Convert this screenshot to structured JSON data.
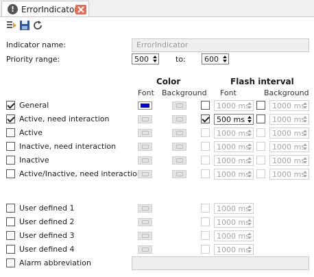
{
  "tab": {
    "title": "ErrorIndicator *"
  },
  "toolbar": {
    "icons": [
      "export-icon",
      "save-icon",
      "refresh-icon"
    ]
  },
  "form": {
    "name_label": "Indicator name:",
    "name_value": "ErrorIndicator",
    "priority_label": "Priority range:",
    "priority_from": "500",
    "priority_to_label": "to:",
    "priority_to": "600"
  },
  "headers": {
    "color": "Color",
    "flash_interval": "Flash interval",
    "font": "Font",
    "background": "Background",
    "flash_font": "Font",
    "flash_background": "Background"
  },
  "rows": [
    {
      "label": "General",
      "checked": true,
      "font_color": "#0000dd",
      "font_flash_checked": false,
      "font_ms": "1000 ms",
      "bg_flash_checked": false,
      "bg_ms": "1000 ms"
    },
    {
      "label": "Active, need interaction",
      "checked": true,
      "font_flash_checked": true,
      "font_ms": "500 ms",
      "bg_flash_checked": false,
      "bg_ms": "1000 ms"
    },
    {
      "label": "Active",
      "checked": false,
      "font_ms": "1000 ms",
      "bg_ms": "1000 ms"
    },
    {
      "label": "Inactive, need interaction",
      "checked": false,
      "font_ms": "1000 ms",
      "bg_ms": "1000 ms"
    },
    {
      "label": "Inactive",
      "checked": false,
      "font_ms": "1000 ms",
      "bg_ms": "1000 ms"
    },
    {
      "label": "Active/Inactive, need interaction",
      "checked": false,
      "font_ms": "1000 ms",
      "bg_ms": "1000 ms"
    }
  ],
  "user_rows": [
    {
      "label": "User defined 1",
      "checked": false,
      "font_ms": "1000 ms"
    },
    {
      "label": "User defined 2",
      "checked": false,
      "font_ms": "1000 ms"
    },
    {
      "label": "User defined 3",
      "checked": false,
      "font_ms": "1000 ms"
    },
    {
      "label": "User defined 4",
      "checked": false,
      "font_ms": "1000 ms"
    }
  ],
  "alarm": {
    "label": "Alarm abbreviation",
    "checked": false,
    "value": ""
  },
  "colors": {
    "accent_close": "#e96a55",
    "font_swatch": "#0000dd"
  }
}
